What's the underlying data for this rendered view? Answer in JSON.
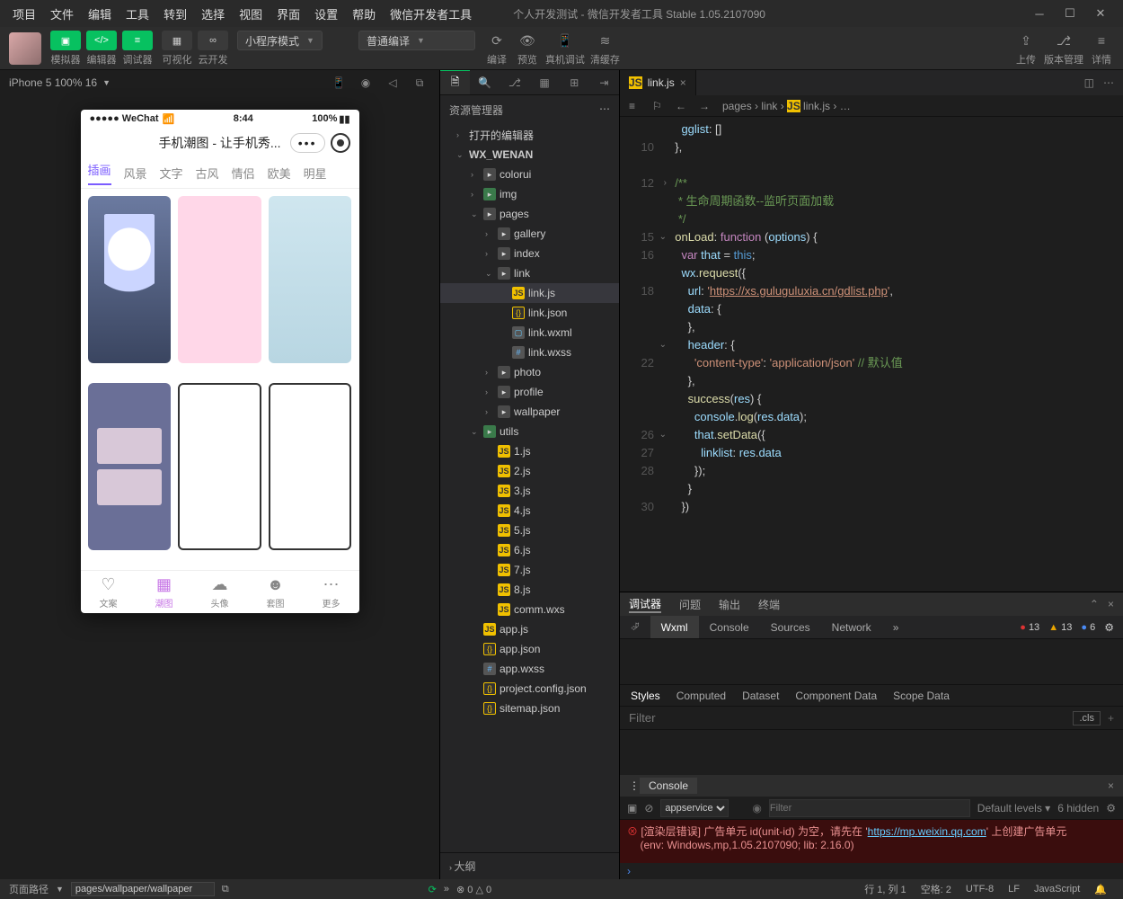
{
  "menubar": [
    "项目",
    "文件",
    "编辑",
    "工具",
    "转到",
    "选择",
    "视图",
    "界面",
    "设置",
    "帮助",
    "微信开发者工具"
  ],
  "window_title": "个人开发测试 - 微信开发者工具 Stable 1.05.2107090",
  "toolbar": {
    "modes": [
      {
        "label": "模拟器"
      },
      {
        "label": "编辑器"
      },
      {
        "label": "调试器"
      }
    ],
    "visual": "可视化",
    "cloud": "云开发",
    "program_mode": "小程序模式",
    "compile_mode": "普通编译",
    "actions": [
      "编译",
      "预览",
      "真机调试",
      "清缓存"
    ],
    "right": [
      "上传",
      "版本管理",
      "详情"
    ]
  },
  "simulator": {
    "device": "iPhone 5 100% 16",
    "phone": {
      "carrier": "●●●●● WeChat",
      "wifi": "📶",
      "time": "8:44",
      "battery": "100%",
      "title": "手机潮图 - 让手机秀...",
      "tabs": [
        "插画",
        "风景",
        "文字",
        "古风",
        "情侣",
        "欧美",
        "明星"
      ],
      "nav": [
        {
          "label": "文案",
          "glyph": "♡"
        },
        {
          "label": "潮图",
          "glyph": "▦"
        },
        {
          "label": "头像",
          "glyph": "☁"
        },
        {
          "label": "套图",
          "glyph": "☻"
        },
        {
          "label": "更多",
          "glyph": "⋯"
        }
      ]
    }
  },
  "explorer": {
    "title": "资源管理器",
    "sections": {
      "open_editors": "打开的编辑器",
      "project": "WX_WENAN"
    },
    "tree": [
      {
        "d": 2,
        "icon": "folder",
        "name": "colorui"
      },
      {
        "d": 2,
        "icon": "folder-img",
        "name": "img"
      },
      {
        "d": 2,
        "icon": "folder",
        "name": "pages",
        "open": true
      },
      {
        "d": 3,
        "icon": "folder",
        "name": "gallery"
      },
      {
        "d": 3,
        "icon": "folder",
        "name": "index"
      },
      {
        "d": 3,
        "icon": "folder",
        "name": "link",
        "open": true
      },
      {
        "d": 4,
        "icon": "js",
        "name": "link.js",
        "sel": true
      },
      {
        "d": 4,
        "icon": "json",
        "name": "link.json"
      },
      {
        "d": 4,
        "icon": "wxml",
        "name": "link.wxml"
      },
      {
        "d": 4,
        "icon": "wxss",
        "name": "link.wxss"
      },
      {
        "d": 3,
        "icon": "folder",
        "name": "photo"
      },
      {
        "d": 3,
        "icon": "folder",
        "name": "profile"
      },
      {
        "d": 3,
        "icon": "folder",
        "name": "wallpaper"
      },
      {
        "d": 2,
        "icon": "folder-img",
        "name": "utils",
        "open": true
      },
      {
        "d": 3,
        "icon": "js",
        "name": "1.js"
      },
      {
        "d": 3,
        "icon": "js",
        "name": "2.js"
      },
      {
        "d": 3,
        "icon": "js",
        "name": "3.js"
      },
      {
        "d": 3,
        "icon": "js",
        "name": "4.js"
      },
      {
        "d": 3,
        "icon": "js",
        "name": "5.js"
      },
      {
        "d": 3,
        "icon": "js",
        "name": "6.js"
      },
      {
        "d": 3,
        "icon": "js",
        "name": "7.js"
      },
      {
        "d": 3,
        "icon": "js",
        "name": "8.js"
      },
      {
        "d": 3,
        "icon": "js",
        "name": "comm.wxs"
      },
      {
        "d": 2,
        "icon": "js",
        "name": "app.js"
      },
      {
        "d": 2,
        "icon": "json",
        "name": "app.json"
      },
      {
        "d": 2,
        "icon": "wxss",
        "name": "app.wxss"
      },
      {
        "d": 2,
        "icon": "json",
        "name": "project.config.json"
      },
      {
        "d": 2,
        "icon": "json",
        "name": "sitemap.json"
      }
    ],
    "outline": "大纲"
  },
  "editor": {
    "tab_name": "link.js",
    "breadcrumbs": [
      "pages",
      "link",
      "link.js",
      "…"
    ],
    "code": [
      {
        "n": "",
        "html": "    <span class='c-prop'>gglist</span>: []"
      },
      {
        "n": "10",
        "html": "  },"
      },
      {
        "n": "",
        "html": ""
      },
      {
        "n": "12",
        "html": "  <span class='c-com'>/**</span>",
        "fold": ">"
      },
      {
        "n": "",
        "html": "<span class='c-com'>   * 生命周期函数--监听页面加载</span>"
      },
      {
        "n": "",
        "html": "<span class='c-com'>   */</span>"
      },
      {
        "n": "15",
        "html": "  <span class='c-fn'>onLoad</span>: <span class='c-kw'>function</span> (<span class='c-var'>options</span>) {",
        "fold": "v"
      },
      {
        "n": "16",
        "html": "    <span class='c-kw'>var</span> <span class='c-var'>that</span> = <span class='c-this'>this</span>;"
      },
      {
        "n": "",
        "html": "    <span class='c-var'>wx</span>.<span class='c-fn'>request</span>({"
      },
      {
        "n": "18",
        "html": "      <span class='c-prop'>url</span>: <span class='c-str'>'</span><span class='c-url'>https://xs.guluguluxia.cn/gdlist.php</span><span class='c-str'>'</span>,"
      },
      {
        "n": "",
        "html": "      <span class='c-prop'>data</span>: {"
      },
      {
        "n": "",
        "html": "      },"
      },
      {
        "n": "",
        "html": "      <span class='c-prop'>header</span>: {",
        "fold": "v"
      },
      {
        "n": "22",
        "html": "        <span class='c-str'>'content-type'</span>: <span class='c-str'>'application/json'</span> <span class='c-com'>// 默认值</span>"
      },
      {
        "n": "",
        "html": "      },"
      },
      {
        "n": "",
        "html": "      <span class='c-fn'>success</span>(<span class='c-var'>res</span>) {"
      },
      {
        "n": "",
        "html": "        <span class='c-var'>console</span>.<span class='c-fn'>log</span>(<span class='c-var'>res</span>.<span class='c-prop'>data</span>);"
      },
      {
        "n": "26",
        "html": "        <span class='c-var'>that</span>.<span class='c-fn'>setData</span>({",
        "fold": "v"
      },
      {
        "n": "27",
        "html": "          <span class='c-prop'>linklist</span>: <span class='c-var'>res</span>.<span class='c-prop'>data</span>"
      },
      {
        "n": "28",
        "html": "        });"
      },
      {
        "n": "",
        "html": "      }"
      },
      {
        "n": "30",
        "html": "    })"
      }
    ]
  },
  "debugger": {
    "top_tabs": [
      "调试器",
      "问题",
      "输出",
      "终端"
    ],
    "devtools_tabs": [
      "Wxml",
      "Console",
      "Sources",
      "Network"
    ],
    "counts": {
      "err": "13",
      "warn": "13",
      "info": "6"
    },
    "styles_tabs": [
      "Styles",
      "Computed",
      "Dataset",
      "Component Data",
      "Scope Data"
    ],
    "filter_placeholder": "Filter",
    "cls": ".cls",
    "console_label": "Console",
    "context": "appservice",
    "levels": "Default levels",
    "hidden": "6 hidden",
    "error_line1": "[渲染层错误] 广告单元 id(unit-id) 为空，请先在 '",
    "error_link": "https://mp.weixin.qq.com",
    "error_line1b": "' 上创建广告单元",
    "error_line2": "(env: Windows,mp,1.05.2107090; lib: 2.16.0)"
  },
  "statusbar": {
    "page_route": "页面路径",
    "path": "pages/wallpaper/wallpaper",
    "warn": "0",
    "err": "0",
    "ln": "行 1, 列 1",
    "spaces": "空格: 2",
    "enc": "UTF-8",
    "eol": "LF",
    "lang": "JavaScript"
  }
}
